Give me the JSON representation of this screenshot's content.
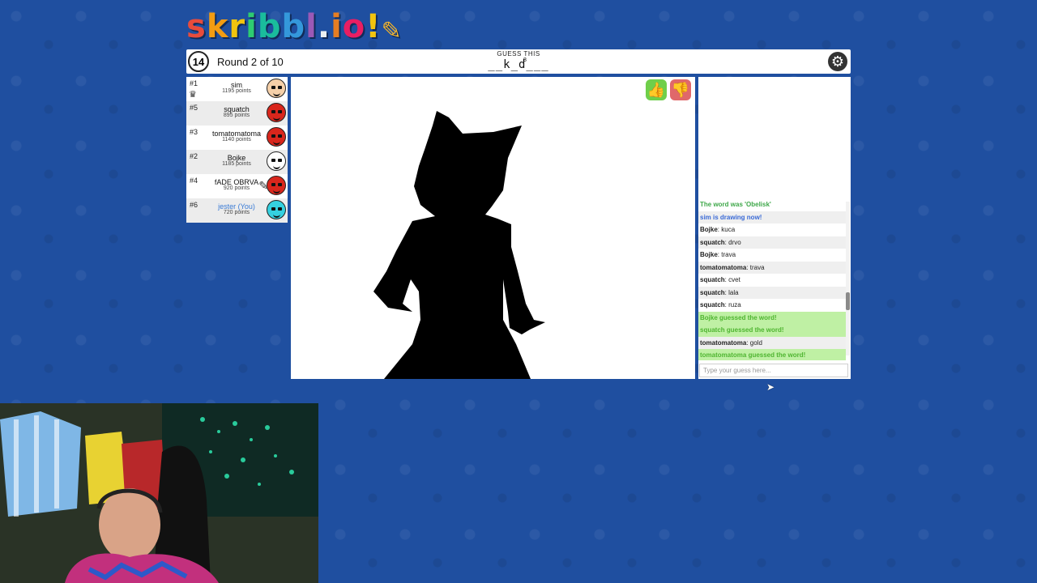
{
  "logo": {
    "text": "skribbl.io!",
    "letters": [
      "s",
      "k",
      "r",
      "i",
      "b",
      "b",
      "l",
      ".",
      "i",
      "o",
      "!"
    ],
    "colors": [
      "#e74c3c",
      "#f39c12",
      "#f1c40f",
      "#2ecc71",
      "#1abc9c",
      "#3498db",
      "#9b59b6",
      "#ecf0f1",
      "#e67e22",
      "#e91e63",
      "#f1c40f"
    ]
  },
  "header": {
    "timer": "14",
    "round": "Round 2 of 10",
    "guess_label": "GUESS THIS",
    "word_hint": "__k_d___",
    "word_length": "8"
  },
  "players": [
    {
      "rank": "#1",
      "name": "sim",
      "points": "1195 points",
      "crown": true,
      "drawing": false,
      "avatar_color": "#f5d0a9",
      "me": false
    },
    {
      "rank": "#5",
      "name": "squatch",
      "points": "895 points",
      "crown": false,
      "drawing": false,
      "avatar_color": "#d9261c",
      "me": false
    },
    {
      "rank": "#3",
      "name": "tomatomatoma",
      "points": "1140 points",
      "crown": false,
      "drawing": false,
      "avatar_color": "#d9261c",
      "me": false
    },
    {
      "rank": "#2",
      "name": "Bojke",
      "points": "1185 points",
      "crown": false,
      "drawing": false,
      "avatar_color": "#ffffff",
      "me": false
    },
    {
      "rank": "#4",
      "name": "fADE OBRVA",
      "points": "920 points",
      "crown": false,
      "drawing": true,
      "avatar_color": "#d9261c",
      "me": false
    },
    {
      "rank": "#6",
      "name": "jester (You)",
      "points": "720 points",
      "crown": false,
      "drawing": false,
      "avatar_color": "#35d1e0",
      "me": true
    }
  ],
  "chat": {
    "messages": [
      {
        "type": "top",
        "text": "The word was 'Obelisk'"
      },
      {
        "type": "sys",
        "text": "sim is drawing now!"
      },
      {
        "type": "msg",
        "user": "Bojke",
        "text": "kuca"
      },
      {
        "type": "msg",
        "user": "squatch",
        "text": "drvo"
      },
      {
        "type": "msg",
        "user": "Bojke",
        "text": "trava"
      },
      {
        "type": "msg",
        "user": "tomatomatoma",
        "text": "trava"
      },
      {
        "type": "msg",
        "user": "squatch",
        "text": "cvet"
      },
      {
        "type": "msg",
        "user": "squatch",
        "text": "lala"
      },
      {
        "type": "msg",
        "user": "squatch",
        "text": "ruza"
      },
      {
        "type": "ok",
        "text": "Bojke guessed the word!"
      },
      {
        "type": "ok",
        "text": "squatch guessed the word!"
      },
      {
        "type": "msg",
        "user": "tomatomatoma",
        "text": "gold"
      },
      {
        "type": "ok",
        "text": "tomatomatoma guessed the word!"
      }
    ],
    "input_placeholder": "Type your guess here..."
  },
  "icons": {
    "clock": "alarm-clock-icon",
    "settings": "gear-icon",
    "like": "thumbs-up-icon",
    "dislike": "thumbs-down-icon",
    "crown": "crown-icon",
    "pen": "pencil-icon"
  }
}
